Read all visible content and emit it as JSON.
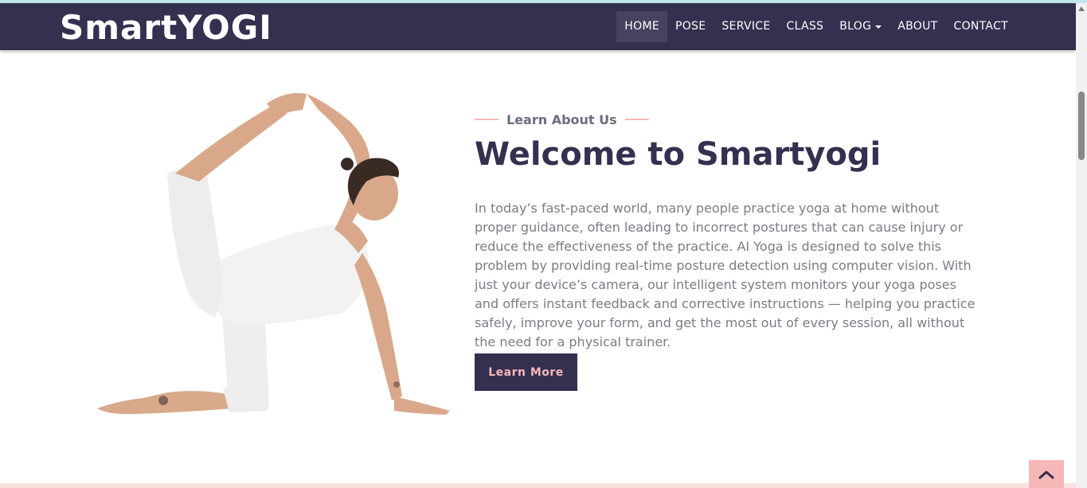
{
  "nav": {
    "brand": "SmartYOGI",
    "items": [
      {
        "label": "HOME"
      },
      {
        "label": "POSE"
      },
      {
        "label": "SERVICE"
      },
      {
        "label": "CLASS"
      },
      {
        "label": "BLOG"
      },
      {
        "label": "ABOUT"
      },
      {
        "label": "CONTACT"
      }
    ],
    "active": "HOME"
  },
  "about": {
    "subtitle": "Learn About Us",
    "title": "Welcome to Smartyogi",
    "description": "In today’s fast-paced world, many people practice yoga at home without proper guidance, often leading to incorrect postures that can cause injury or reduce the effectiveness of the practice. AI Yoga is designed to solve this problem by providing real-time posture detection using computer vision. With just your device’s camera, our intelligent system monitors your yoga poses and offers instant feedback and corrective instructions — helping you practice safely, improve your form, and get the most out of every session, all without the need for a physical trainer.",
    "button": "Learn More"
  },
  "icons": {
    "back_to_top": "chevron-up-icon",
    "dropdown": "caret-down-icon"
  },
  "colors": {
    "primary": "#34304f",
    "accent": "#f6b7b7",
    "text": "#7b7b86"
  }
}
